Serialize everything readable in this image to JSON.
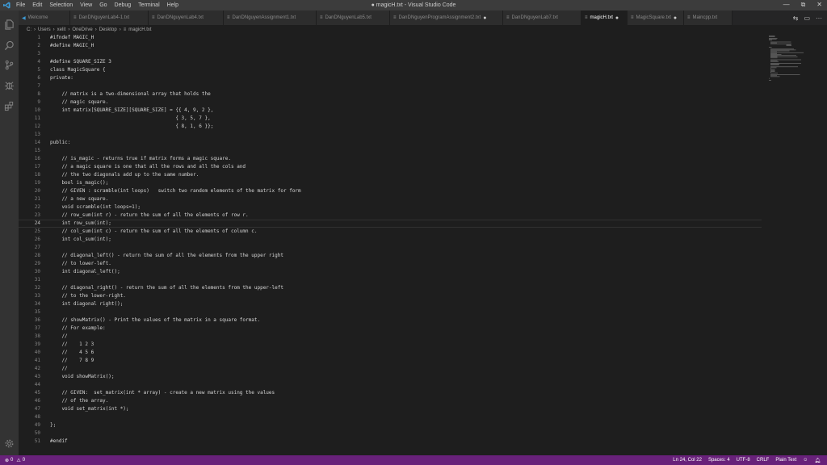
{
  "window": {
    "title": "● magicH.txt - Visual Studio Code",
    "menu": [
      "File",
      "Edit",
      "Selection",
      "View",
      "Go",
      "Debug",
      "Terminal",
      "Help"
    ],
    "controls": [
      "—",
      "⧉",
      "✕"
    ]
  },
  "activity_bar": {
    "items": [
      "explorer-icon",
      "search-icon",
      "source-control-icon",
      "debug-icon",
      "extensions-icon"
    ],
    "bottom": "settings-gear-icon"
  },
  "tabs": [
    {
      "label": "Welcome",
      "icon": "vscode-icon",
      "active": false,
      "dirty": false,
      "width": 64
    },
    {
      "label": "DanDNguyenLab4-1.txt",
      "icon": "text-icon",
      "active": false,
      "dirty": false,
      "width": 97
    },
    {
      "label": "DanDNguyenLab4.txt",
      "icon": "text-icon",
      "active": false,
      "dirty": false,
      "width": 93
    },
    {
      "label": "DanDNguyenAssignment1.txt",
      "icon": "text-icon",
      "active": false,
      "dirty": false,
      "width": 115
    },
    {
      "label": "DanDNguyenLab5.txt",
      "icon": "text-icon",
      "active": false,
      "dirty": false,
      "width": 91
    },
    {
      "label": "DanDNguyenProgramAssignment2.txt",
      "icon": "text-icon",
      "active": false,
      "dirty": true,
      "width": 140
    },
    {
      "label": "DanDNguyenLab7.txt",
      "icon": "text-icon",
      "active": false,
      "dirty": false,
      "width": 97
    },
    {
      "label": "magicH.txt",
      "icon": "text-icon",
      "active": true,
      "dirty": true,
      "width": 57
    },
    {
      "label": "MagicSquare.txt",
      "icon": "text-icon",
      "active": false,
      "dirty": true,
      "width": 70
    },
    {
      "label": "Maincpp.txt",
      "icon": "text-icon",
      "active": false,
      "dirty": false,
      "width": 60
    }
  ],
  "tab_actions": [
    "split-editor-icon",
    "layout-icon",
    "more-actions-icon"
  ],
  "breadcrumb": [
    "C:",
    "Users",
    "xelit",
    "OneDrive",
    "Desktop",
    "magicH.txt"
  ],
  "editor": {
    "current_line": 24,
    "lines": [
      "#ifndef MAGIC_H",
      "#define MAGIC_H",
      "",
      "#define SQUARE_SIZE 3",
      "class MagicSquare {",
      "private:",
      "",
      "    // matrix is a two-dimensional array that holds the",
      "    // magic square.",
      "    int matrix[SQUARE_SIZE][SQUARE_SIZE] = {{ 4, 9, 2 },",
      "                                           { 3, 5, 7 },",
      "                                           { 8, 1, 6 }};",
      "",
      "public:",
      "",
      "    // is_magic - returns true if matrix forms a magic square.",
      "    // a magic square is one that all the rows and all the cols and",
      "    // the two diagonals add up to the same number.",
      "    bool is_magic();",
      "    // GIVEN : scramble(int loops)   switch two random elements of the matrix for form",
      "    // a new square.",
      "    void scramble(int loops=1);",
      "    // row_sum(int r) - return the sum of all the elements of row r.",
      "    int row_sum(int);",
      "    // col_sum(int c) - return the sum of all the elements of column c.",
      "    int col_sum(int);",
      "",
      "    // diagonal_left() - return the sum of all the elements from the upper right",
      "    // to lower-left.",
      "    int diagonal_left();",
      "",
      "    // diagonal_right() - return the sum of all the elements from the upper-left",
      "    // to the lower-right.",
      "    int diagonal right();",
      "",
      "    // showMatrix() - Print the values of the matrix in a square format.",
      "    // For example:",
      "    //",
      "    //    1 2 3",
      "    //    4 5 6",
      "    //    7 8 9",
      "    //",
      "    void showMatrix();",
      "",
      "    // GIVEN:  set_matrix(int * array) - create a new matrix using the values",
      "    // of the array.",
      "    void set_matrix(int *);",
      "",
      "};",
      "",
      "#endif"
    ]
  },
  "minimap": {
    "icon": "minimap"
  },
  "statusbar": {
    "errors": "0",
    "warnings": "0",
    "position": "Ln 24, Col 22",
    "spaces": "Spaces: 4",
    "encoding": "UTF-8",
    "eol": "CRLF",
    "language": "Plain Text",
    "icons": [
      "smiley-feedback-icon",
      "bell-icon"
    ]
  },
  "colors": {
    "statusbar": "#68217a",
    "editor_bg": "#1e1e1e",
    "activity_bg": "#333333",
    "tab_bg": "#2d2d2d"
  }
}
